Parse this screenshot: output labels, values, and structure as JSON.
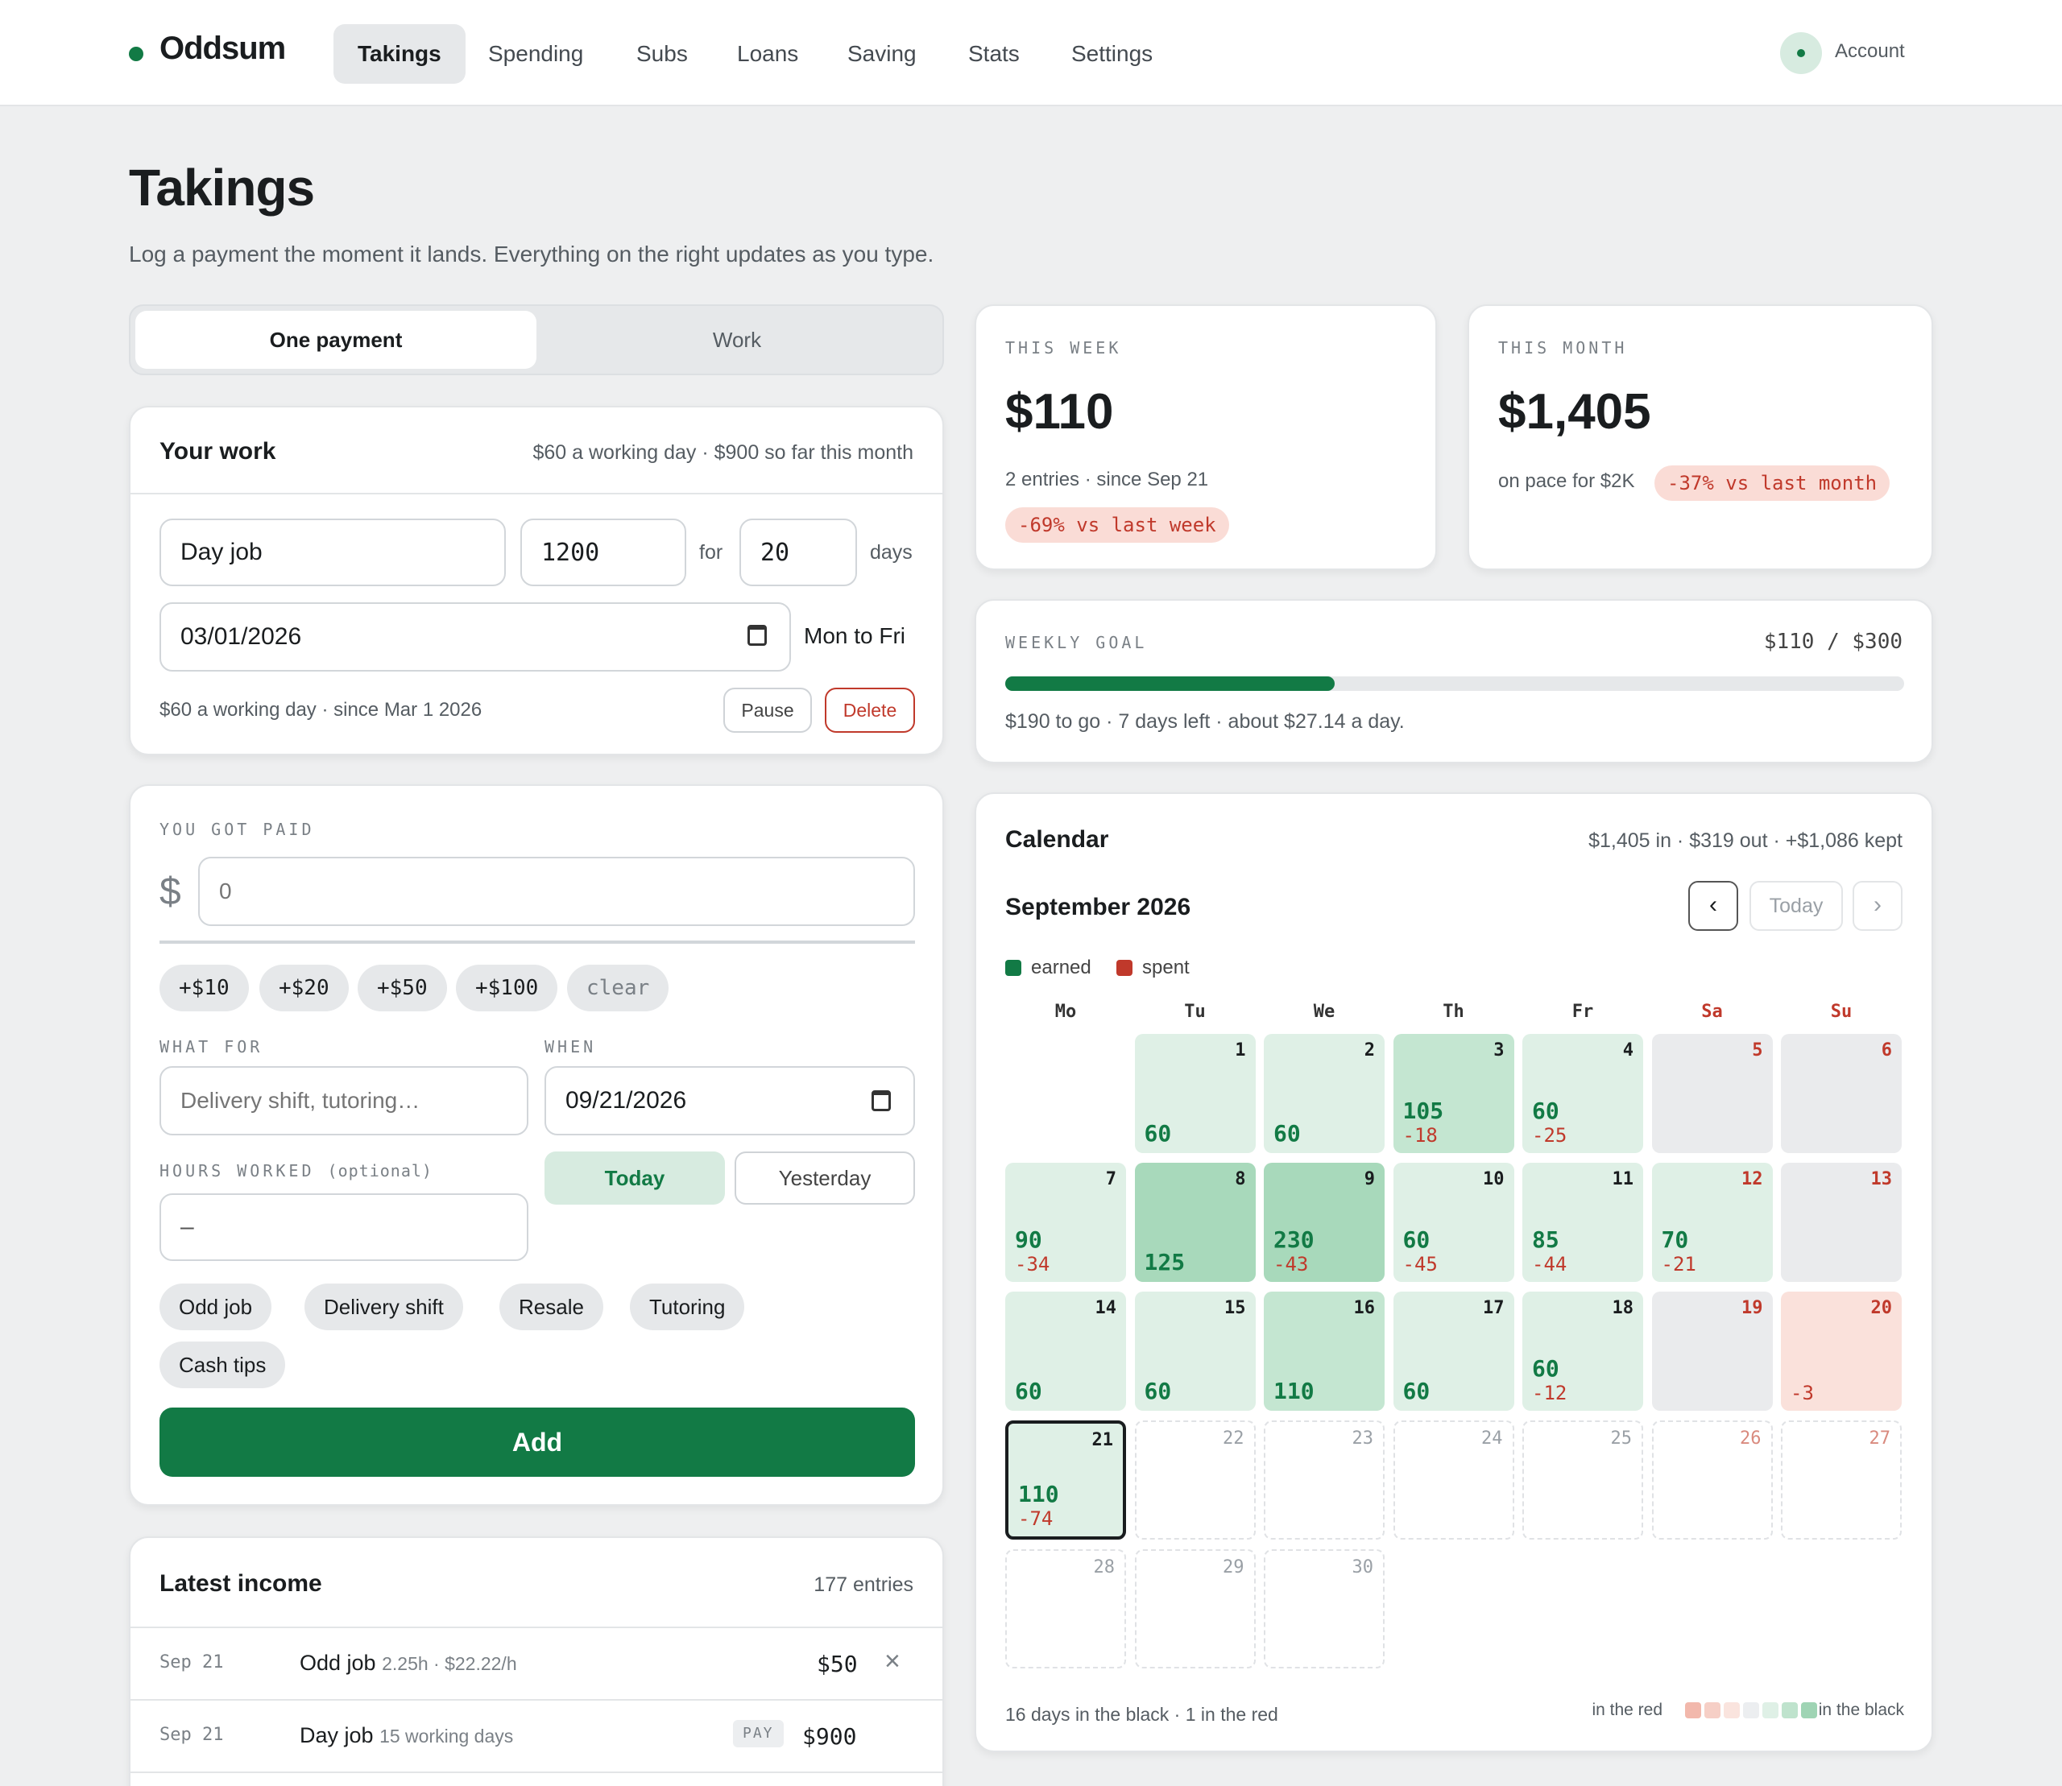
{
  "app": {
    "name": "Oddsum",
    "account_label": "Account"
  },
  "nav": [
    "Takings",
    "Spending",
    "Subs",
    "Loans",
    "Saving",
    "Stats",
    "Settings"
  ],
  "page": {
    "title": "Takings",
    "subtitle": "Log a payment the moment it lands. Everything on the right updates as you type."
  },
  "mode_tabs": {
    "one": "One payment",
    "work": "Work"
  },
  "work": {
    "title": "Your work",
    "summary": "$60 a working day · $900 so far this month",
    "name": "Day job",
    "amount": "1200",
    "for": "for",
    "days": "20",
    "days_label": "days",
    "date": "03/01/2026",
    "schedule": "Mon to Fri",
    "note": "$60 a working day · since Mar 1 2026",
    "pause": "Pause",
    "delete": "Delete"
  },
  "paid": {
    "label": "YOU GOT PAID",
    "currency": "$",
    "placeholder": "0",
    "quick": [
      "+$10",
      "+$20",
      "+$50",
      "+$100",
      "clear"
    ],
    "what_label": "WHAT FOR",
    "what_placeholder": "Delivery shift, tutoring…",
    "when_label": "WHEN",
    "when": "09/21/2026",
    "today": "Today",
    "yesterday": "Yesterday",
    "hours_label": "HOURS WORKED",
    "hours_optional": "(optional)",
    "hours_placeholder": "–",
    "tags": [
      "Odd job",
      "Delivery shift",
      "Resale",
      "Tutoring",
      "Cash tips"
    ],
    "add": "Add"
  },
  "latest": {
    "title": "Latest income",
    "count": "177 entries",
    "rows": [
      {
        "date": "Sep 21",
        "name": "Odd job",
        "meta": "2.25h · $22.22/h",
        "badge": "",
        "amount": "$50"
      },
      {
        "date": "Sep 21",
        "name": "Day job",
        "meta": "15 working days",
        "badge": "PAY",
        "amount": "$900"
      }
    ]
  },
  "week": {
    "label": "THIS WEEK",
    "amount": "$110",
    "meta": "2 entries · since Sep 21",
    "badge": "-69% vs last week"
  },
  "month": {
    "label": "THIS MONTH",
    "amount": "$1,405",
    "meta": "on pace for $2K",
    "badge": "-37% vs last month"
  },
  "goal": {
    "label": "WEEKLY GOAL",
    "value": "$110 / $300",
    "progress": 0.3667,
    "note": "$190 to go · 7 days left · about $27.14 a day."
  },
  "calendar": {
    "title": "Calendar",
    "summary": "$1,405 in · $319 out · +$1,086 kept",
    "month": "September 2026",
    "today": "Today",
    "prev": "‹",
    "next": "›",
    "legend_earned": "earned",
    "legend_spent": "spent",
    "weekdays": [
      "Mo",
      "Tu",
      "We",
      "Th",
      "Fr",
      "Sa",
      "Su"
    ],
    "days": [
      {
        "d": 1,
        "earn": "60",
        "spent": "",
        "shade": 1
      },
      {
        "d": 2,
        "earn": "60",
        "spent": "",
        "shade": 1
      },
      {
        "d": 3,
        "earn": "105",
        "spent": "-18",
        "shade": 2
      },
      {
        "d": 4,
        "earn": "60",
        "spent": "-25",
        "shade": 1
      },
      {
        "d": 5,
        "earn": "",
        "spent": "",
        "shade": 0
      },
      {
        "d": 6,
        "earn": "",
        "spent": "",
        "shade": 0
      },
      {
        "d": 7,
        "earn": "90",
        "spent": "-34",
        "shade": 1
      },
      {
        "d": 8,
        "earn": "125",
        "spent": "",
        "shade": 3
      },
      {
        "d": 9,
        "earn": "230",
        "spent": "-43",
        "shade": 3
      },
      {
        "d": 10,
        "earn": "60",
        "spent": "-45",
        "shade": 1
      },
      {
        "d": 11,
        "earn": "85",
        "spent": "-44",
        "shade": 1
      },
      {
        "d": 12,
        "earn": "70",
        "spent": "-21",
        "shade": 1
      },
      {
        "d": 13,
        "earn": "",
        "spent": "",
        "shade": 0
      },
      {
        "d": 14,
        "earn": "60",
        "spent": "",
        "shade": 1
      },
      {
        "d": 15,
        "earn": "60",
        "spent": "",
        "shade": 1
      },
      {
        "d": 16,
        "earn": "110",
        "spent": "",
        "shade": 2
      },
      {
        "d": 17,
        "earn": "60",
        "spent": "",
        "shade": 1
      },
      {
        "d": 18,
        "earn": "60",
        "spent": "-12",
        "shade": 1
      },
      {
        "d": 19,
        "earn": "",
        "spent": "",
        "shade": 0
      },
      {
        "d": 20,
        "earn": "",
        "spent": "-3",
        "shade": -1
      },
      {
        "d": 21,
        "earn": "110",
        "spent": "-74",
        "shade": 1,
        "today": true
      },
      {
        "d": 22,
        "future": true
      },
      {
        "d": 23,
        "future": true
      },
      {
        "d": 24,
        "future": true
      },
      {
        "d": 25,
        "future": true
      },
      {
        "d": 26,
        "future": true
      },
      {
        "d": 27,
        "future": true
      },
      {
        "d": 28,
        "future": true
      },
      {
        "d": 29,
        "future": true
      },
      {
        "d": 30,
        "future": true
      }
    ],
    "footer": "16 days in the black · 1 in the red",
    "scale_red": "in the red",
    "scale_black": "in the black"
  },
  "colors": {
    "accent": "#127a45",
    "red": "#c0392b"
  }
}
